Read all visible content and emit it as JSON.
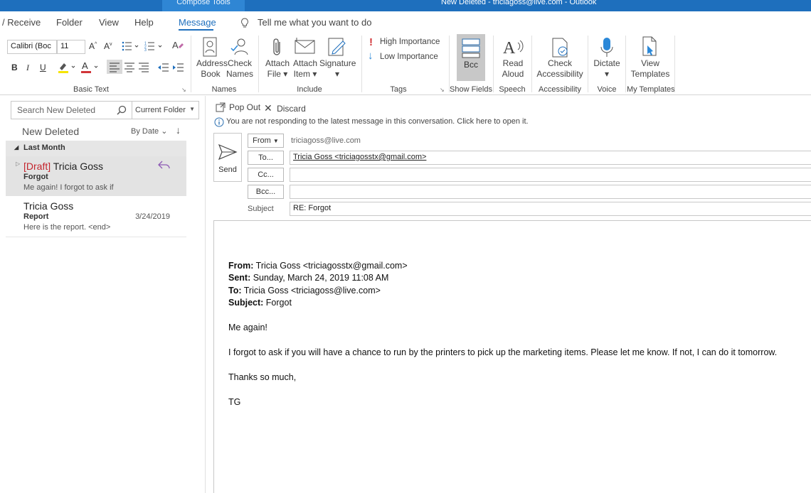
{
  "titlebar": {
    "context_tab": "Compose Tools",
    "title": "New Deleted - triciagoss@live.com - Outlook"
  },
  "menu": {
    "tabs": [
      "/ Receive",
      "Folder",
      "View",
      "Help",
      "Message"
    ],
    "active": "Message",
    "tellme": "Tell me what you want to do"
  },
  "ribbon": {
    "basic_text": {
      "label": "Basic Text",
      "font": "Calibri (Boc",
      "size": "11"
    },
    "names": {
      "label": "Names",
      "address_book": [
        "Address",
        "Book"
      ],
      "check_names": [
        "Check",
        "Names"
      ]
    },
    "include": {
      "label": "Include",
      "attach_file": [
        "Attach",
        "File ▾"
      ],
      "attach_item": [
        "Attach",
        "Item ▾"
      ],
      "signature": [
        "Signature",
        "▾"
      ]
    },
    "tags": {
      "label": "Tags",
      "high": "High Importance",
      "low": "Low Importance"
    },
    "show_fields": {
      "label": "Show Fields",
      "bcc": "Bcc"
    },
    "speech": {
      "label": "Speech",
      "read_aloud": [
        "Read",
        "Aloud"
      ]
    },
    "accessibility": {
      "label": "Accessibility",
      "check": [
        "Check",
        "Accessibility"
      ]
    },
    "voice": {
      "label": "Voice",
      "dictate": [
        "Dictate",
        "▾"
      ]
    },
    "templates": {
      "label": "My Templates",
      "view": [
        "View",
        "Templates"
      ]
    }
  },
  "leftpane": {
    "search_placeholder": "Search New Deleted",
    "scope": "Current Folder",
    "folder_title": "New Deleted",
    "sort": "By Date",
    "group": "Last Month",
    "items": [
      {
        "draft": "[Draft]",
        "sender": "Tricia Goss",
        "subject": "Forgot",
        "preview": "Me again!  I forgot to ask if",
        "date": ""
      },
      {
        "draft": "",
        "sender": "Tricia Goss",
        "subject": "Report",
        "preview": "Here is the report. <end>",
        "date": "3/24/2019"
      }
    ]
  },
  "compose": {
    "popout": "Pop Out",
    "discard": "Discard",
    "info": "You are not responding to the latest message in this conversation. Click here to open it.",
    "send": "Send",
    "from_btn": "From",
    "from_value": "triciagoss@live.com",
    "to_btn": "To...",
    "to_value": "Tricia Goss <triciagosstx@gmail.com>",
    "cc_btn": "Cc...",
    "bcc_btn": "Bcc...",
    "subject_label": "Subject",
    "subject_value": "RE: Forgot",
    "body": {
      "from_label": "From:",
      "from": " Tricia Goss <triciagosstx@gmail.com>",
      "sent_label": "Sent:",
      "sent": " Sunday, March 24, 2019 11:08 AM",
      "to_label": "To:",
      "to": " Tricia Goss <triciagoss@live.com>",
      "subject_label": "Subject:",
      "subject": " Forgot",
      "line1": "Me again!",
      "line2": "I forgot to ask if you will have a chance to run by the printers to pick up the marketing items. Please let me know. If not, I can do it tomorrow.",
      "line3": "Thanks so much,",
      "line4": "TG"
    }
  },
  "colors": {
    "accent": "#1e6fbd",
    "draft": "#c4262e",
    "selected": "#e3e3e3"
  }
}
